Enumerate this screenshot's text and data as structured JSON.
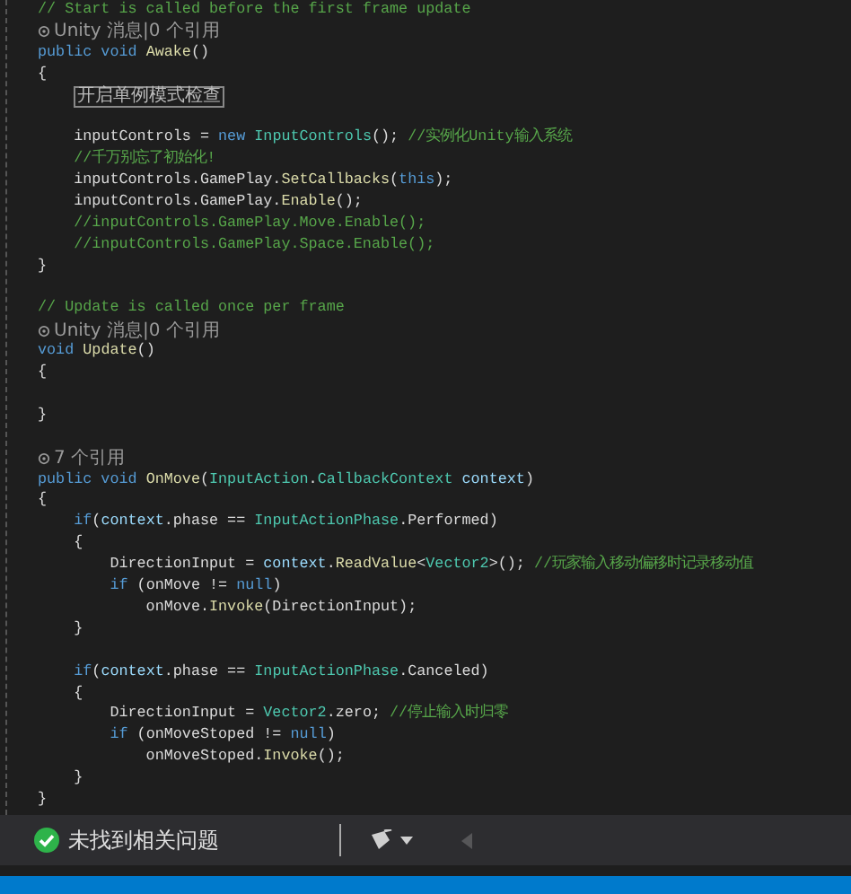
{
  "editor": {
    "lines": [
      {
        "kind": "code",
        "tokens": [
          {
            "text": "// Start is called before the first frame update",
            "kind": "comment"
          }
        ]
      },
      {
        "kind": "lens",
        "text": "Unity 消息|0 个引用"
      },
      {
        "kind": "code",
        "tokens": [
          {
            "text": "public void ",
            "kind": "keyword"
          },
          {
            "text": "Awake",
            "kind": "method"
          },
          {
            "text": "()",
            "kind": "plain"
          }
        ]
      },
      {
        "kind": "code",
        "tokens": [
          {
            "text": "{",
            "kind": "plain"
          }
        ]
      },
      {
        "kind": "region",
        "text": "开启单例模式检查"
      },
      {
        "kind": "blank"
      },
      {
        "kind": "code",
        "tokens": [
          {
            "text": "    inputControls = ",
            "kind": "plain"
          },
          {
            "text": "new ",
            "kind": "keyword"
          },
          {
            "text": "InputControls",
            "kind": "type"
          },
          {
            "text": "(); ",
            "kind": "plain"
          },
          {
            "text": "//实例化Unity输入系统",
            "kind": "comment"
          }
        ]
      },
      {
        "kind": "code",
        "tokens": [
          {
            "text": "    //千万别忘了初始化!",
            "kind": "comment"
          }
        ]
      },
      {
        "kind": "code",
        "tokens": [
          {
            "text": "    inputControls.GamePlay.",
            "kind": "plain"
          },
          {
            "text": "SetCallbacks",
            "kind": "method"
          },
          {
            "text": "(",
            "kind": "plain"
          },
          {
            "text": "this",
            "kind": "keyword"
          },
          {
            "text": ");",
            "kind": "plain"
          }
        ]
      },
      {
        "kind": "code",
        "tokens": [
          {
            "text": "    inputControls.GamePlay.",
            "kind": "plain"
          },
          {
            "text": "Enable",
            "kind": "method"
          },
          {
            "text": "();",
            "kind": "plain"
          }
        ]
      },
      {
        "kind": "code",
        "tokens": [
          {
            "text": "    //inputControls.GamePlay.Move.Enable();",
            "kind": "comment"
          }
        ]
      },
      {
        "kind": "code",
        "tokens": [
          {
            "text": "    //inputControls.GamePlay.Space.Enable();",
            "kind": "comment"
          }
        ]
      },
      {
        "kind": "code",
        "tokens": [
          {
            "text": "}",
            "kind": "plain"
          }
        ]
      },
      {
        "kind": "blank"
      },
      {
        "kind": "code",
        "tokens": [
          {
            "text": "// Update is called once per frame",
            "kind": "comment"
          }
        ]
      },
      {
        "kind": "lens",
        "text": "Unity 消息|0 个引用"
      },
      {
        "kind": "code",
        "tokens": [
          {
            "text": "void ",
            "kind": "keyword"
          },
          {
            "text": "Update",
            "kind": "method"
          },
          {
            "text": "()",
            "kind": "plain"
          }
        ]
      },
      {
        "kind": "code",
        "tokens": [
          {
            "text": "{",
            "kind": "plain"
          }
        ]
      },
      {
        "kind": "blank"
      },
      {
        "kind": "code",
        "tokens": [
          {
            "text": "}",
            "kind": "plain"
          }
        ]
      },
      {
        "kind": "blank"
      },
      {
        "kind": "lens",
        "text": "7 个引用"
      },
      {
        "kind": "code",
        "tokens": [
          {
            "text": "public void ",
            "kind": "keyword"
          },
          {
            "text": "OnMove",
            "kind": "method"
          },
          {
            "text": "(",
            "kind": "plain"
          },
          {
            "text": "InputAction",
            "kind": "type"
          },
          {
            "text": ".",
            "kind": "plain"
          },
          {
            "text": "CallbackContext",
            "kind": "type"
          },
          {
            "text": " context",
            "kind": "param"
          },
          {
            "text": ")",
            "kind": "plain"
          }
        ]
      },
      {
        "kind": "code",
        "tokens": [
          {
            "text": "{",
            "kind": "plain"
          }
        ]
      },
      {
        "kind": "code",
        "tokens": [
          {
            "text": "    if",
            "kind": "keyword"
          },
          {
            "text": "(",
            "kind": "plain"
          },
          {
            "text": "context",
            "kind": "param"
          },
          {
            "text": ".phase == ",
            "kind": "plain"
          },
          {
            "text": "InputActionPhase",
            "kind": "type"
          },
          {
            "text": ".Performed)",
            "kind": "plain"
          }
        ]
      },
      {
        "kind": "code",
        "tokens": [
          {
            "text": "    {",
            "kind": "plain"
          }
        ]
      },
      {
        "kind": "code",
        "tokens": [
          {
            "text": "        DirectionInput = ",
            "kind": "plain"
          },
          {
            "text": "context",
            "kind": "param"
          },
          {
            "text": ".",
            "kind": "plain"
          },
          {
            "text": "ReadValue",
            "kind": "method"
          },
          {
            "text": "<",
            "kind": "plain"
          },
          {
            "text": "Vector2",
            "kind": "type"
          },
          {
            "text": ">(); ",
            "kind": "plain"
          },
          {
            "text": "//玩家输入移动偏移时记录移动值",
            "kind": "comment"
          }
        ]
      },
      {
        "kind": "code",
        "tokens": [
          {
            "text": "        if ",
            "kind": "keyword"
          },
          {
            "text": "(onMove != ",
            "kind": "plain"
          },
          {
            "text": "null",
            "kind": "keyword"
          },
          {
            "text": ")",
            "kind": "plain"
          }
        ]
      },
      {
        "kind": "code",
        "tokens": [
          {
            "text": "            onMove.",
            "kind": "plain"
          },
          {
            "text": "Invoke",
            "kind": "method"
          },
          {
            "text": "(DirectionInput);",
            "kind": "plain"
          }
        ]
      },
      {
        "kind": "code",
        "tokens": [
          {
            "text": "    }",
            "kind": "plain"
          }
        ]
      },
      {
        "kind": "blank"
      },
      {
        "kind": "code",
        "tokens": [
          {
            "text": "    if",
            "kind": "keyword"
          },
          {
            "text": "(",
            "kind": "plain"
          },
          {
            "text": "context",
            "kind": "param"
          },
          {
            "text": ".phase == ",
            "kind": "plain"
          },
          {
            "text": "InputActionPhase",
            "kind": "type"
          },
          {
            "text": ".Canceled)",
            "kind": "plain"
          }
        ]
      },
      {
        "kind": "code",
        "tokens": [
          {
            "text": "    {",
            "kind": "plain"
          }
        ]
      },
      {
        "kind": "code",
        "tokens": [
          {
            "text": "        DirectionInput = ",
            "kind": "plain"
          },
          {
            "text": "Vector2",
            "kind": "type"
          },
          {
            "text": ".zero; ",
            "kind": "plain"
          },
          {
            "text": "//停止输入时归零",
            "kind": "comment"
          }
        ]
      },
      {
        "kind": "code",
        "tokens": [
          {
            "text": "        if ",
            "kind": "keyword"
          },
          {
            "text": "(onMoveStoped != ",
            "kind": "plain"
          },
          {
            "text": "null",
            "kind": "keyword"
          },
          {
            "text": ")",
            "kind": "plain"
          }
        ]
      },
      {
        "kind": "code",
        "tokens": [
          {
            "text": "            onMoveStoped.",
            "kind": "plain"
          },
          {
            "text": "Invoke",
            "kind": "method"
          },
          {
            "text": "();",
            "kind": "plain"
          }
        ]
      },
      {
        "kind": "code",
        "tokens": [
          {
            "text": "    }",
            "kind": "plain"
          }
        ]
      },
      {
        "kind": "code",
        "tokens": [
          {
            "text": "}",
            "kind": "plain"
          }
        ]
      }
    ]
  },
  "status_bar": {
    "message": "未找到相关问题",
    "navigate_back": {
      "disabled": true
    }
  }
}
